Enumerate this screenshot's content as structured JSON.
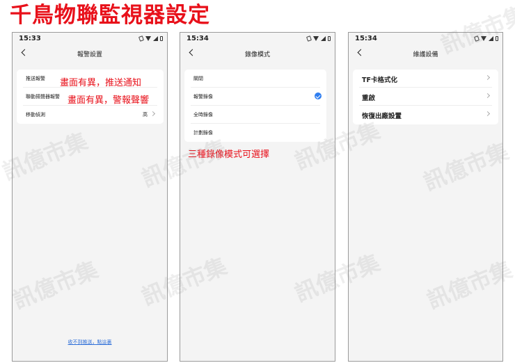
{
  "banner": {
    "title": "千鳥物聯監視器設定"
  },
  "watermark_text": "訊億市集",
  "screens": [
    {
      "status": {
        "time": "15:33"
      },
      "nav_title": "報警設置",
      "rows": [
        {
          "label": "推送報警"
        },
        {
          "label": "聯動揚聲器報警"
        },
        {
          "label": "移動偵測",
          "value": "高"
        }
      ],
      "annotations": [
        "畫面有異，推送通知",
        "畫面有異，警報聲響"
      ],
      "footer_link": "收不到推送，點這裏"
    },
    {
      "status": {
        "time": "15:34"
      },
      "nav_title": "錄像模式",
      "rows": [
        {
          "label": "關閉"
        },
        {
          "label": "報警錄像",
          "selected": true
        },
        {
          "label": "全時錄像"
        },
        {
          "label": "計劃錄像"
        }
      ],
      "annotation": "三種錄像模式可選擇"
    },
    {
      "status": {
        "time": "15:34"
      },
      "nav_title": "維護設備",
      "rows": [
        {
          "label": "TF卡格式化"
        },
        {
          "label": "重啟"
        },
        {
          "label": "恢復出廠設置"
        }
      ]
    }
  ],
  "colors": {
    "annotation": "#e8101a",
    "accent": "#2f7ef0",
    "link": "#2f6fd8"
  }
}
